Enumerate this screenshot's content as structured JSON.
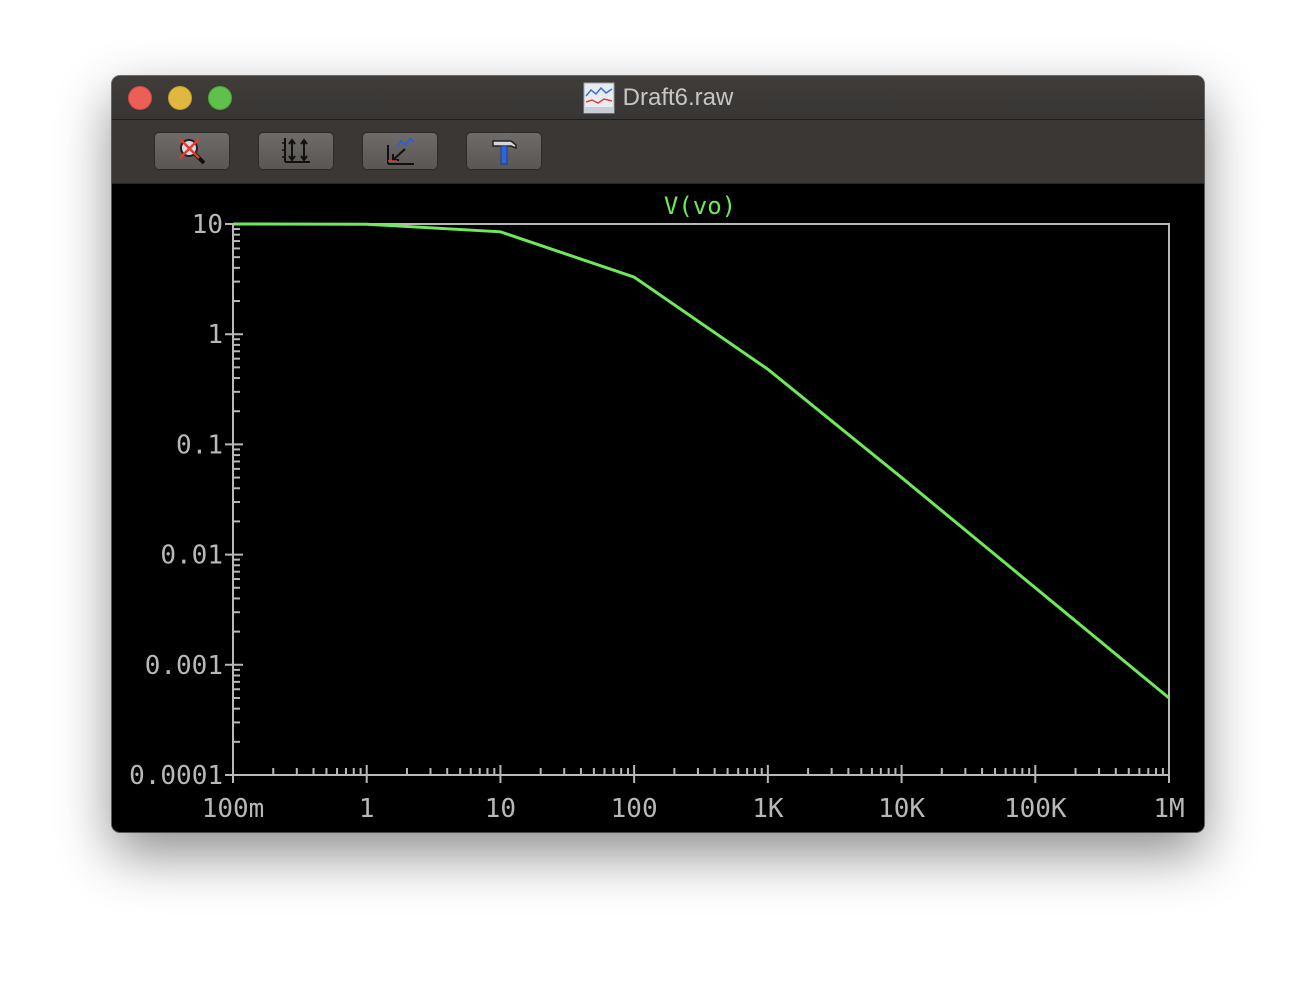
{
  "window": {
    "title": "Draft6.raw",
    "title_icon": "waveform-document-icon"
  },
  "toolbar": {
    "buttons": [
      {
        "name": "zoom-cancel-button",
        "icon": "magnifier-cross-icon"
      },
      {
        "name": "autorange-button",
        "icon": "axis-autorange-icon"
      },
      {
        "name": "zoom-fit-button",
        "icon": "zoom-to-fit-icon"
      },
      {
        "name": "settings-button",
        "icon": "hammer-icon"
      }
    ]
  },
  "colors": {
    "trace": "#6fe85a",
    "axis": "#b8b8b8",
    "background": "#000000",
    "title_bar": "#3c3a38"
  },
  "chart_data": {
    "type": "line",
    "title": "V(vo)",
    "x_scale": "log",
    "y_scale": "log",
    "xlim": [
      0.1,
      1000000
    ],
    "ylim": [
      0.0001,
      10
    ],
    "x_ticks": [
      {
        "value": 0.1,
        "label": "100m"
      },
      {
        "value": 1,
        "label": "1"
      },
      {
        "value": 10,
        "label": "10"
      },
      {
        "value": 100,
        "label": "100"
      },
      {
        "value": 1000,
        "label": "1K"
      },
      {
        "value": 10000,
        "label": "10K"
      },
      {
        "value": 100000,
        "label": "100K"
      },
      {
        "value": 1000000,
        "label": "1M"
      }
    ],
    "y_ticks": [
      {
        "value": 10,
        "label": "10"
      },
      {
        "value": 1,
        "label": "1"
      },
      {
        "value": 0.1,
        "label": "0.1"
      },
      {
        "value": 0.01,
        "label": "0.01"
      },
      {
        "value": 0.001,
        "label": "0.001"
      },
      {
        "value": 0.0001,
        "label": "0.0001"
      }
    ],
    "grid": false,
    "series": [
      {
        "name": "V(vo)",
        "x": [
          0.1,
          1,
          10,
          100,
          1000,
          10000,
          100000,
          1000000
        ],
        "y": [
          10,
          9.95,
          8.5,
          3.3,
          0.48,
          0.05,
          0.005,
          0.0005
        ]
      }
    ]
  }
}
